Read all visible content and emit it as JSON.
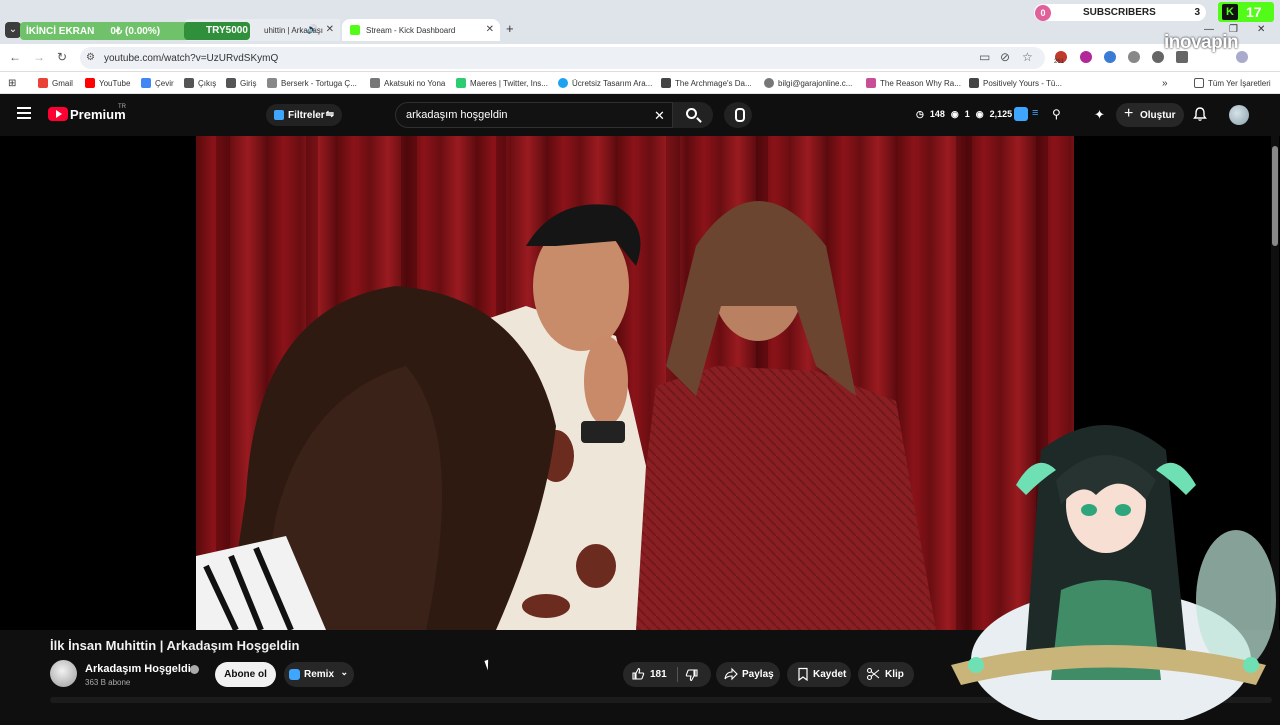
{
  "browser": {
    "tabs": [
      {
        "label": "uhittin | Arkadaşı",
        "active": false
      },
      {
        "label": "Stream - Kick Dashboard",
        "active": true
      }
    ],
    "url": "youtube.com/watch?v=UzURvdSKymQ",
    "bookmarks": [
      "Gmail",
      "YouTube",
      "Çevir",
      "Çıkış",
      "Giriş",
      "Berserk - Tortuga Ç...",
      "Akatsuki no Yona",
      "Maeres | Twitter, Ins...",
      "Ücretsiz Tasarım Ara...",
      "The Archmage's Da...",
      "bilgi@garajonline.c...",
      "The Reason Why Ra...",
      "Positively Yours - Tü..."
    ],
    "all_bookmarks": "Tüm Yer İşaretleri",
    "extension_badge": "261"
  },
  "overlay": {
    "screen_label": "İKİNCİ EKRAN",
    "goal_progress": "0₺ (0.00%)",
    "goal_target": "TRY5000",
    "subscribers_label": "SUBSCRIBERS",
    "subscribers_left": "0",
    "subscribers_right": "3",
    "kick_count": "17",
    "sponsor": "inovapin"
  },
  "youtube": {
    "brand": "Premium",
    "region": "TR",
    "filters_label": "Filtreler",
    "search_value": "arkadaşım hoşgeldin",
    "stats": {
      "views": "148",
      "eye": "1",
      "count": "2,125"
    },
    "create_label": "Oluştur"
  },
  "video": {
    "title": "İlk İnsan Muhittin | Arkadaşım Hoşgeldin",
    "channel": "Arkadaşım Hoşgeldin",
    "subscribers": "363 B abone",
    "subscribe_label": "Abone ol",
    "remix_label": "Remix",
    "likes": "181",
    "share_label": "Paylaş",
    "save_label": "Kaydet",
    "clip_label": "Klip"
  }
}
